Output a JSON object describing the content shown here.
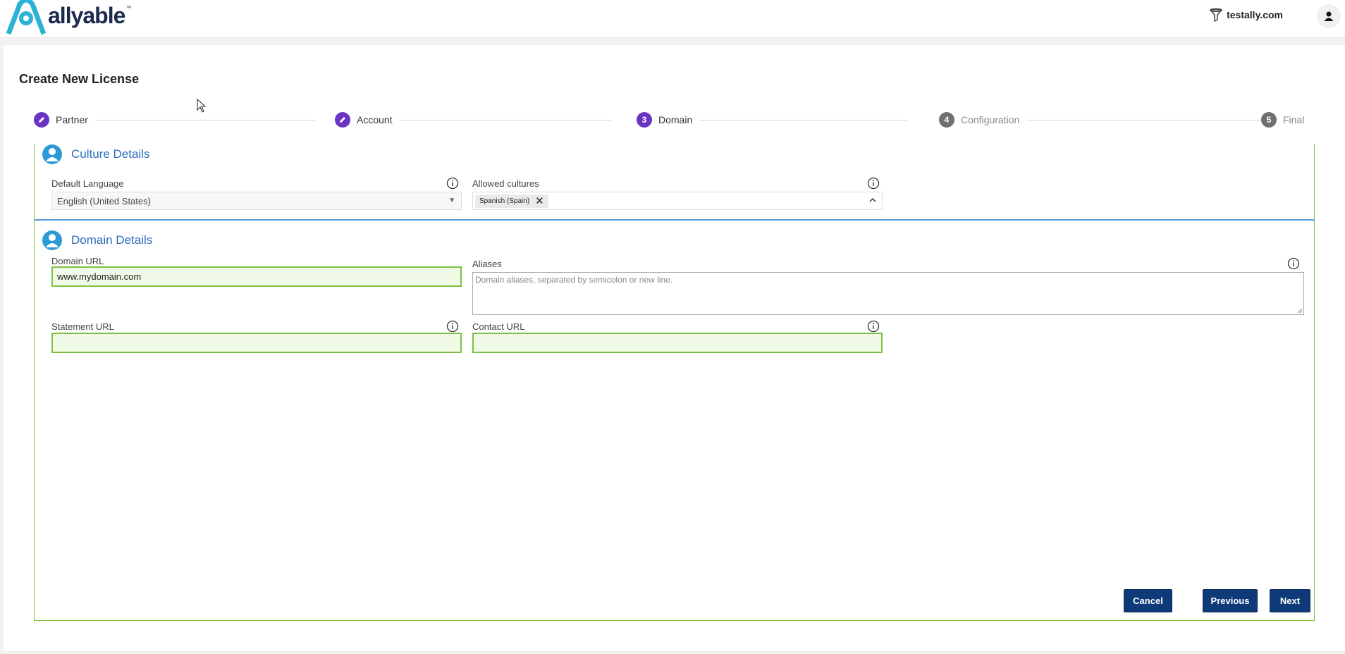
{
  "header": {
    "brand": "allyable",
    "trademark": "™",
    "tenant": "testally.com"
  },
  "page": {
    "title": "Create New License"
  },
  "stepper": {
    "steps": [
      {
        "number": "1",
        "label": "Partner",
        "state": "done"
      },
      {
        "number": "2",
        "label": "Account",
        "state": "done"
      },
      {
        "number": "3",
        "label": "Domain",
        "state": "active"
      },
      {
        "number": "4",
        "label": "Configuration",
        "state": "pending"
      },
      {
        "number": "5",
        "label": "Final",
        "state": "pending"
      }
    ]
  },
  "culture": {
    "title": "Culture Details",
    "default_language_label": "Default Language",
    "default_language_value": "English (United States)",
    "allowed_cultures_label": "Allowed cultures",
    "allowed_cultures_chips": [
      "Spanish (Spain)"
    ]
  },
  "domain": {
    "title": "Domain Details",
    "domain_url_label": "Domain URL",
    "domain_url_value": "www.mydomain.com",
    "aliases_label": "Aliases",
    "aliases_placeholder": "Domain aliases, separated by semicolon or new line.",
    "statement_url_label": "Statement URL",
    "statement_url_value": "",
    "contact_url_label": "Contact URL",
    "contact_url_value": ""
  },
  "actions": {
    "cancel": "Cancel",
    "previous": "Previous",
    "next": "Next"
  },
  "colors": {
    "accent_purple": "#6a35c2",
    "section_blue": "#2b6dbf",
    "valid_green": "#7cc242",
    "button_navy": "#0e3a7a"
  }
}
